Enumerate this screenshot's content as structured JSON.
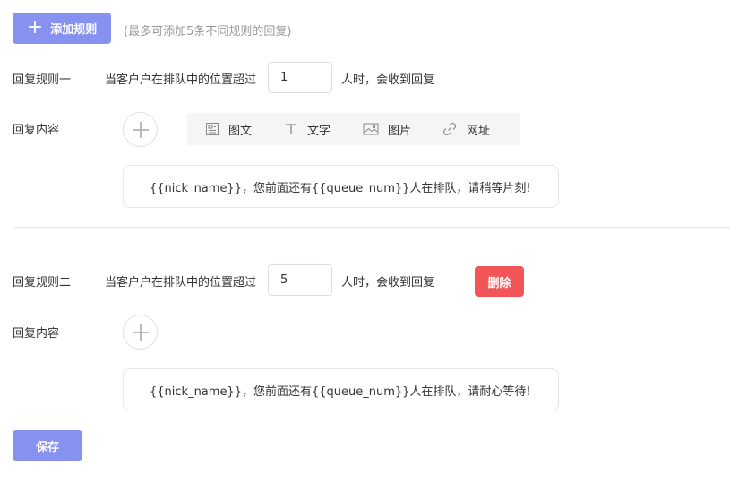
{
  "header": {
    "add_rule_label": "添加规则",
    "add_rule_icon": "plus-icon",
    "hint": "(最多可添加5条不同规则的回复)"
  },
  "rules": [
    {
      "name": "回复规则一",
      "condition_prefix": "当客户户在排队中的位置超过",
      "position_value": "1",
      "condition_suffix": "人时，会收到回复",
      "content_label": "回复内容",
      "message": "{{nick_name}}，您前面还有{{queue_num}}人在排队，请稍等片刻!"
    },
    {
      "name": "回复规则二",
      "condition_prefix": "当客户户在排队中的位置超过",
      "position_value": "5",
      "condition_suffix": "人时，会收到回复",
      "content_label": "回复内容",
      "delete_label": "删除",
      "message": "{{nick_name}}，您前面还有{{queue_num}}人在排队，请耐心等待!"
    }
  ],
  "toolbar": {
    "items": [
      {
        "label": "图文",
        "icon": "article-icon"
      },
      {
        "label": "文字",
        "icon": "text-icon"
      },
      {
        "label": "图片",
        "icon": "image-icon"
      },
      {
        "label": "网址",
        "icon": "link-icon"
      }
    ]
  },
  "footer": {
    "save_label": "保存"
  },
  "colors": {
    "primary": "#8691f0",
    "danger": "#f25557",
    "hint": "#999999",
    "toolbar_bg": "#f5f5f7"
  }
}
